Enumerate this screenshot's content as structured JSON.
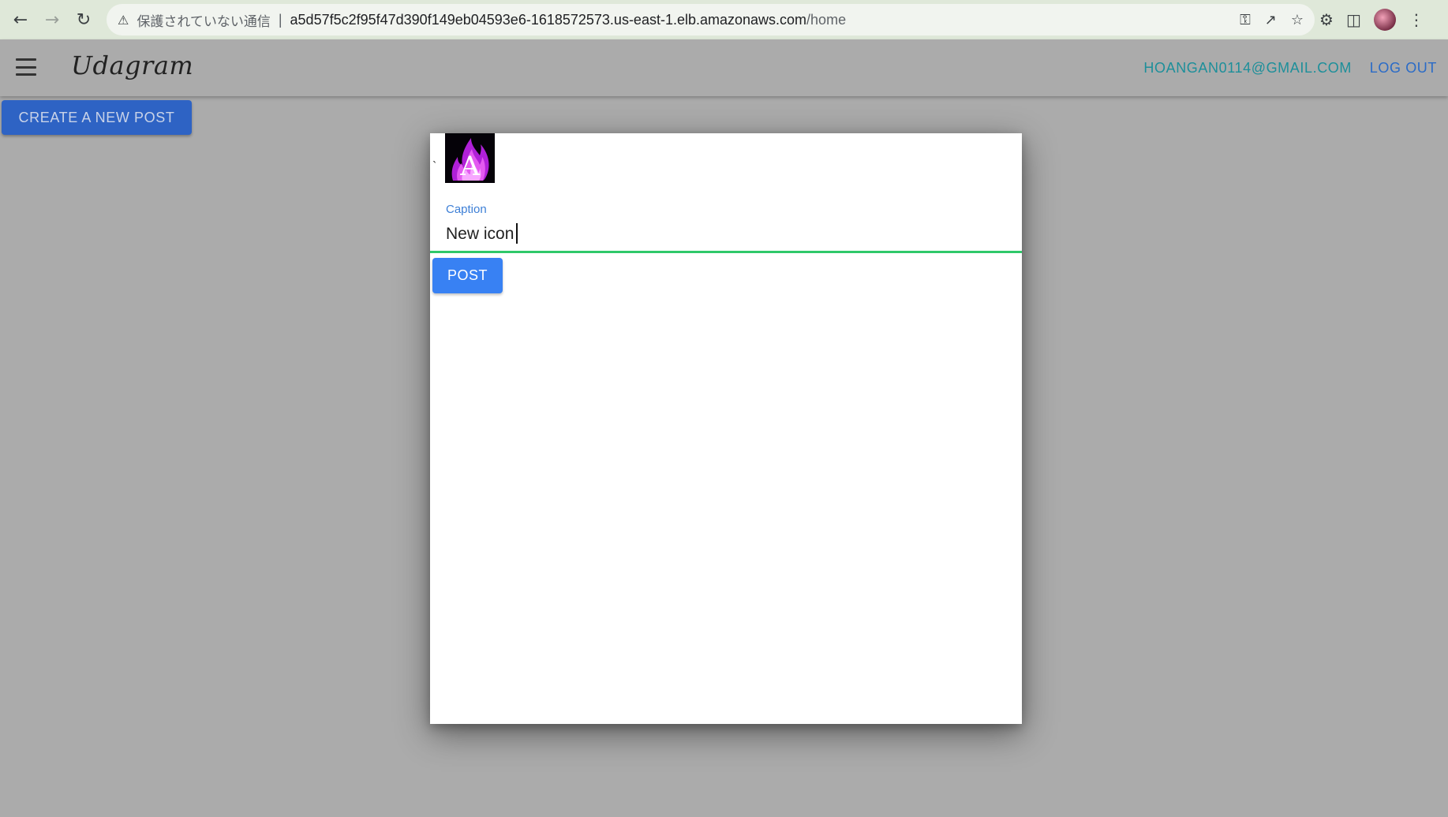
{
  "browser": {
    "security_label": "保護されていない通信",
    "url_host": "a5d57f5c2f95f47d390f149eb04593e6-1618572573.us-east-1.elb.amazonaws.com",
    "url_path": "/home"
  },
  "app": {
    "brand": "Udagram",
    "user_email": "HOANGAN0114@GMAIL.COM",
    "logout_label": "LOG OUT",
    "create_post_label": "CREATE A NEW POST"
  },
  "modal": {
    "backtick": "`",
    "caption_label": "Caption",
    "caption_value": "New icon",
    "post_label": "POST"
  },
  "colors": {
    "accent_blue": "#3881f3",
    "input_underline": "#2fc86a",
    "email_color": "#1d8f9a",
    "logout_color": "#2a6bc7"
  }
}
